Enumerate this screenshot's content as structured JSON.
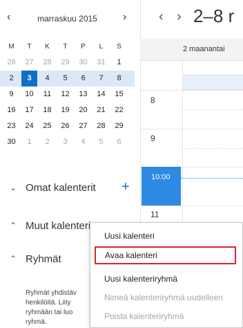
{
  "mini_calendar": {
    "month_label": "marraskuu 2015",
    "prev_icon": "chevron-left-icon",
    "next_icon": "chevron-right-icon",
    "weekdays": [
      "M",
      "T",
      "K",
      "T",
      "P",
      "L",
      "S"
    ],
    "weeks": [
      [
        "26",
        "27",
        "28",
        "29",
        "30",
        "31",
        "1"
      ],
      [
        "2",
        "3",
        "4",
        "5",
        "6",
        "7",
        "8"
      ],
      [
        "9",
        "10",
        "11",
        "12",
        "13",
        "14",
        "15"
      ],
      [
        "16",
        "17",
        "18",
        "19",
        "20",
        "21",
        "22"
      ],
      [
        "23",
        "24",
        "25",
        "26",
        "27",
        "28",
        "29"
      ],
      [
        "30",
        "1",
        "2",
        "3",
        "4",
        "5",
        "6"
      ]
    ],
    "selected_day": "3",
    "selected_color": "#0f6fc6",
    "week_highlight_color": "#dbe9f7"
  },
  "groups": {
    "my_calendars": {
      "label": "Omat kalenterit",
      "chevron_icon": "chevron-down-icon",
      "add_icon": "plus-icon"
    },
    "other_calendars": {
      "label": "Muut kalenterit",
      "chevron_icon": "chevron-up-icon"
    },
    "groups": {
      "label": "Ryhmät",
      "chevron_icon": "chevron-up-icon",
      "description_lines": [
        "Ryhmät yhdistäv",
        "henkilöitä. Liity",
        "ryhmään tai luo",
        "ryhmä."
      ]
    }
  },
  "week_view": {
    "range_title": "2–8 r",
    "prev_icon": "chevron-left-icon",
    "next_icon": "chevron-right-icon",
    "day_header": "2 maanantai",
    "hours": [
      "8",
      "9",
      "10:00",
      "11"
    ],
    "current_hour": "10:00",
    "accent_color": "#2d8ae3"
  },
  "context_menu": {
    "items": [
      {
        "label": "Uusi kalenteri",
        "enabled": true,
        "highlighted": false
      },
      {
        "label": "Avaa kalenteri",
        "enabled": true,
        "highlighted": true
      },
      {
        "label": "Uusi kalenteriryhmä",
        "enabled": true,
        "highlighted": false
      },
      {
        "label": "Nimeä kalenteriryhmä uudelleen",
        "enabled": false,
        "highlighted": false
      },
      {
        "label": "Poista kalenteriryhmä",
        "enabled": false,
        "highlighted": false
      }
    ],
    "highlight_color": "#d8262c"
  }
}
